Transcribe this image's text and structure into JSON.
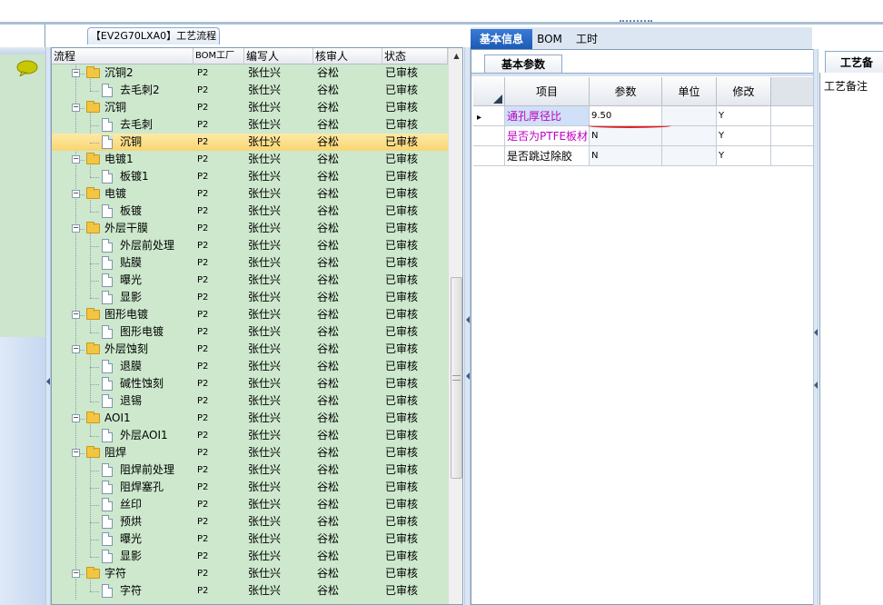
{
  "tree_panel_title": "【EV2G70LXA0】工艺流程",
  "tree_columns": [
    "流程",
    "BOM工厂",
    "编写人",
    "核审人",
    "状态"
  ],
  "tree_rows": [
    {
      "label": "沉铜2",
      "kind": "folder",
      "factory": "P2",
      "writer": "张仕兴",
      "reviewer": "谷松",
      "status": "已审核"
    },
    {
      "label": "去毛刺2",
      "kind": "doc",
      "factory": "P2",
      "writer": "张仕兴",
      "reviewer": "谷松",
      "status": "已审核"
    },
    {
      "label": "沉铜",
      "kind": "folder",
      "factory": "P2",
      "writer": "张仕兴",
      "reviewer": "谷松",
      "status": "已审核"
    },
    {
      "label": "去毛刺",
      "kind": "doc",
      "factory": "P2",
      "writer": "张仕兴",
      "reviewer": "谷松",
      "status": "已审核"
    },
    {
      "label": "沉铜",
      "kind": "doc",
      "factory": "P2",
      "writer": "张仕兴",
      "reviewer": "谷松",
      "status": "已审核",
      "selected": true
    },
    {
      "label": "电镀1",
      "kind": "folder",
      "factory": "P2",
      "writer": "张仕兴",
      "reviewer": "谷松",
      "status": "已审核"
    },
    {
      "label": "板镀1",
      "kind": "doc",
      "factory": "P2",
      "writer": "张仕兴",
      "reviewer": "谷松",
      "status": "已审核"
    },
    {
      "label": "电镀",
      "kind": "folder",
      "factory": "P2",
      "writer": "张仕兴",
      "reviewer": "谷松",
      "status": "已审核"
    },
    {
      "label": "板镀",
      "kind": "doc",
      "factory": "P2",
      "writer": "张仕兴",
      "reviewer": "谷松",
      "status": "已审核"
    },
    {
      "label": "外层干膜",
      "kind": "folder",
      "factory": "P2",
      "writer": "张仕兴",
      "reviewer": "谷松",
      "status": "已审核"
    },
    {
      "label": "外层前处理",
      "kind": "doc",
      "factory": "P2",
      "writer": "张仕兴",
      "reviewer": "谷松",
      "status": "已审核"
    },
    {
      "label": "贴膜",
      "kind": "doc",
      "factory": "P2",
      "writer": "张仕兴",
      "reviewer": "谷松",
      "status": "已审核"
    },
    {
      "label": "曝光",
      "kind": "doc",
      "factory": "P2",
      "writer": "张仕兴",
      "reviewer": "谷松",
      "status": "已审核"
    },
    {
      "label": "显影",
      "kind": "doc",
      "factory": "P2",
      "writer": "张仕兴",
      "reviewer": "谷松",
      "status": "已审核"
    },
    {
      "label": "图形电镀",
      "kind": "folder",
      "factory": "P2",
      "writer": "张仕兴",
      "reviewer": "谷松",
      "status": "已审核"
    },
    {
      "label": "图形电镀",
      "kind": "doc",
      "factory": "P2",
      "writer": "张仕兴",
      "reviewer": "谷松",
      "status": "已审核"
    },
    {
      "label": "外层蚀刻",
      "kind": "folder",
      "factory": "P2",
      "writer": "张仕兴",
      "reviewer": "谷松",
      "status": "已审核"
    },
    {
      "label": "退膜",
      "kind": "doc",
      "factory": "P2",
      "writer": "张仕兴",
      "reviewer": "谷松",
      "status": "已审核"
    },
    {
      "label": "碱性蚀刻",
      "kind": "doc",
      "factory": "P2",
      "writer": "张仕兴",
      "reviewer": "谷松",
      "status": "已审核"
    },
    {
      "label": "退锡",
      "kind": "doc",
      "factory": "P2",
      "writer": "张仕兴",
      "reviewer": "谷松",
      "status": "已审核"
    },
    {
      "label": "AOI1",
      "kind": "folder",
      "factory": "P2",
      "writer": "张仕兴",
      "reviewer": "谷松",
      "status": "已审核"
    },
    {
      "label": "外层AOI1",
      "kind": "doc",
      "factory": "P2",
      "writer": "张仕兴",
      "reviewer": "谷松",
      "status": "已审核"
    },
    {
      "label": "阻焊",
      "kind": "folder",
      "factory": "P2",
      "writer": "张仕兴",
      "reviewer": "谷松",
      "status": "已审核"
    },
    {
      "label": "阻焊前处理",
      "kind": "doc",
      "factory": "P2",
      "writer": "张仕兴",
      "reviewer": "谷松",
      "status": "已审核"
    },
    {
      "label": "阻焊塞孔",
      "kind": "doc",
      "factory": "P2",
      "writer": "张仕兴",
      "reviewer": "谷松",
      "status": "已审核"
    },
    {
      "label": "丝印",
      "kind": "doc",
      "factory": "P2",
      "writer": "张仕兴",
      "reviewer": "谷松",
      "status": "已审核"
    },
    {
      "label": "预烘",
      "kind": "doc",
      "factory": "P2",
      "writer": "张仕兴",
      "reviewer": "谷松",
      "status": "已审核"
    },
    {
      "label": "曝光",
      "kind": "doc",
      "factory": "P2",
      "writer": "张仕兴",
      "reviewer": "谷松",
      "status": "已审核"
    },
    {
      "label": "显影",
      "kind": "doc",
      "factory": "P2",
      "writer": "张仕兴",
      "reviewer": "谷松",
      "status": "已审核"
    },
    {
      "label": "字符",
      "kind": "folder",
      "factory": "P2",
      "writer": "张仕兴",
      "reviewer": "谷松",
      "status": "已审核"
    },
    {
      "label": "字符",
      "kind": "doc",
      "factory": "P2",
      "writer": "张仕兴",
      "reviewer": "谷松",
      "status": "已审核"
    }
  ],
  "main_tabs": [
    "基本信息",
    "BOM",
    "工时"
  ],
  "sub_tab": "基本参数",
  "param_columns": [
    "项目",
    "参数",
    "单位",
    "修改"
  ],
  "param_rows": [
    {
      "item": "通孔厚径比",
      "value": "9.50",
      "unit": "",
      "modify": "Y"
    },
    {
      "item": "是否为PTFE板材",
      "value": "N",
      "unit": "",
      "modify": "Y"
    },
    {
      "item": "是否跳过除胶",
      "value": "N",
      "unit": "",
      "modify": "Y"
    }
  ],
  "right_tab": "工艺备",
  "right_label": "工艺备注",
  "colors": {
    "tree_bg": "#cde8cd",
    "selected_row": "#f9d572",
    "tab_active": "#1c5bb5",
    "link_text": "#c000c0"
  }
}
